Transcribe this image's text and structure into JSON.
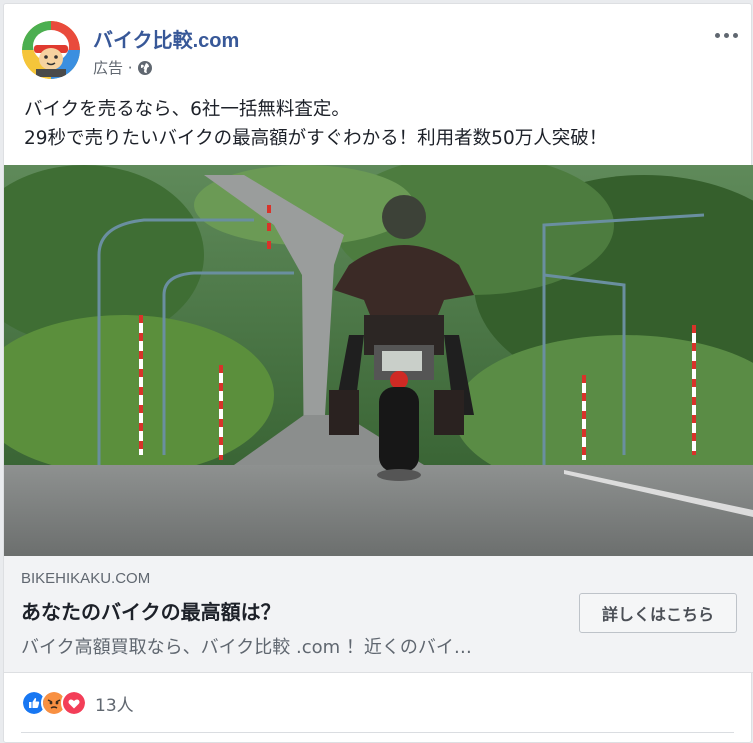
{
  "post": {
    "page_name": "バイク比較.com",
    "sponsored_label": "広告 ·",
    "body_lines": [
      "バイクを売るなら、6社一括無料査定。",
      "29秒で売りたいバイクの最高額がすぐわかる！利用者数50万人突破！"
    ],
    "more_icon": "ellipsis-icon",
    "privacy_icon": "globe-icon"
  },
  "link_preview": {
    "domain": "BIKEHIKAKU.COM",
    "headline": "あなたのバイクの最高額は？",
    "description": "バイク高額買取なら、バイク比較 .com ！近くのバイ…",
    "cta_label": "詳しくはこちら"
  },
  "reactions": {
    "types": [
      "like",
      "angry",
      "love"
    ],
    "count_label": "13人"
  },
  "colors": {
    "brand_link": "#385898",
    "like": "#1877f2",
    "angry": "#f7714b",
    "love": "#f33e58"
  }
}
